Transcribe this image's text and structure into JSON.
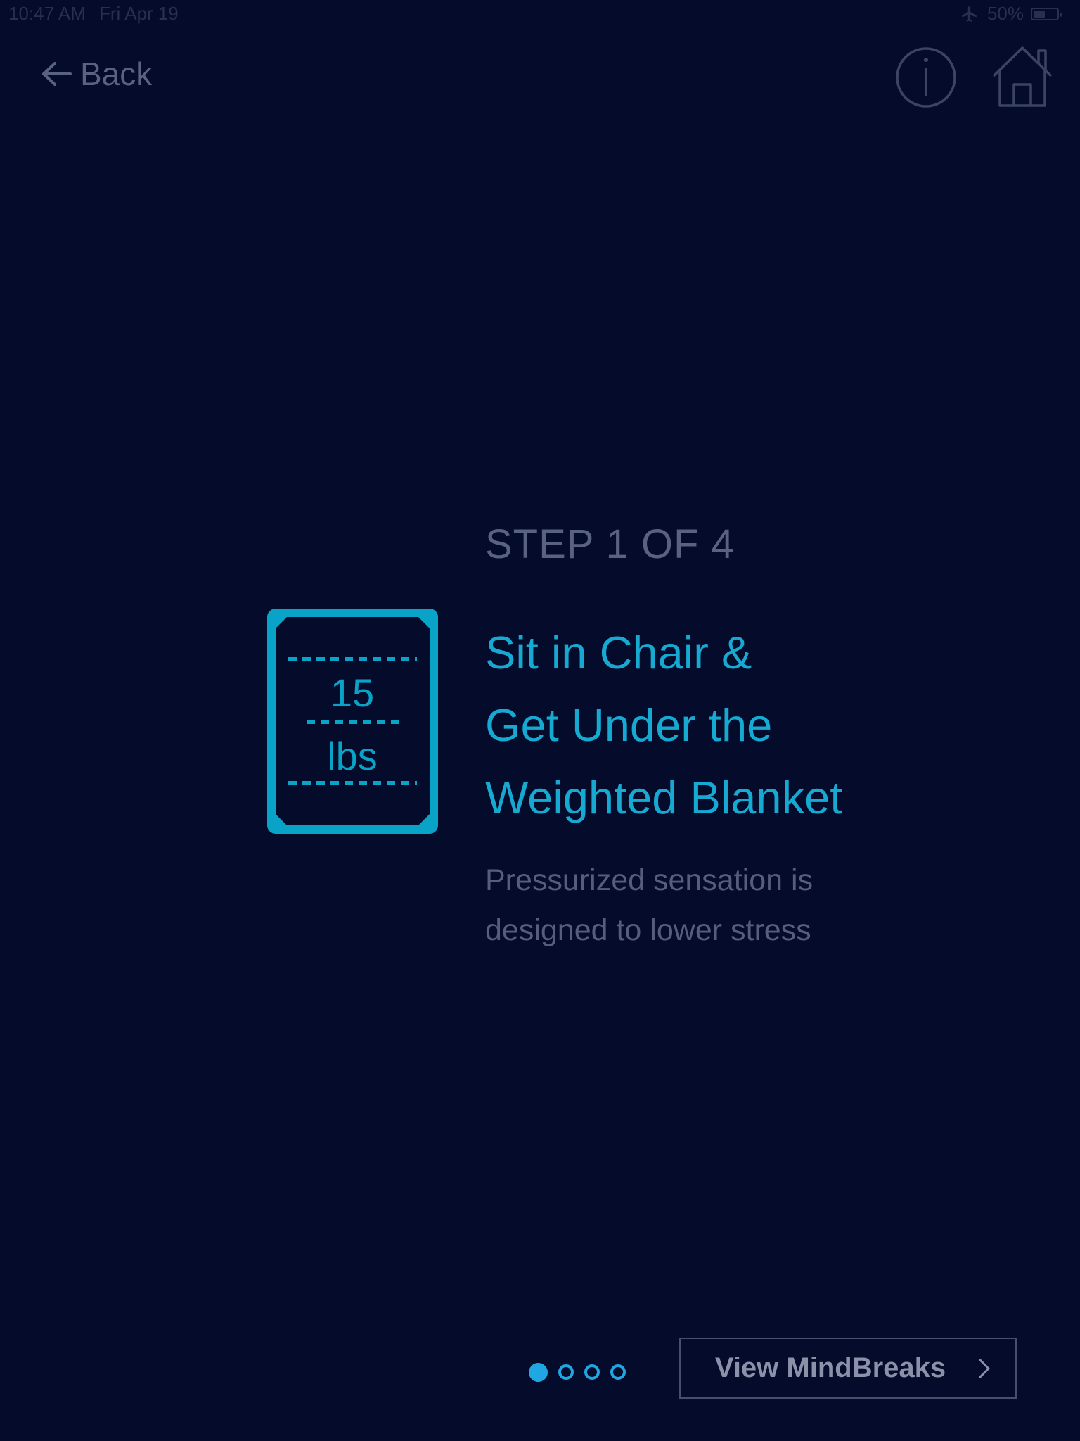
{
  "status_bar": {
    "time": "10:47 AM",
    "date": "Fri Apr 19",
    "battery": "50%",
    "battery_level": 0.5
  },
  "nav": {
    "back_label": "Back"
  },
  "icon": {
    "weight_number": "15",
    "weight_unit": "lbs"
  },
  "step": {
    "label": "STEP 1 OF 4",
    "title_lines": [
      "Sit in Chair &",
      "Get Under the",
      "Weighted Blanket"
    ],
    "description_lines": [
      "Pressurized sensation is",
      "designed to lower stress"
    ]
  },
  "pager": {
    "total": 4,
    "current": 1
  },
  "cta": {
    "label": "View MindBreaks"
  },
  "colors": {
    "background": "#050c2b",
    "accent": "#16a9d1",
    "muted": "#59627e"
  }
}
